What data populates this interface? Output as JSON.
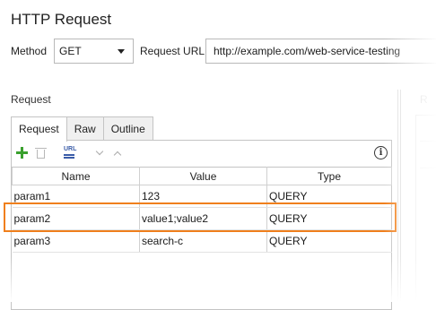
{
  "window": {
    "title": "HTTP Request"
  },
  "request_line": {
    "method_label": "Method",
    "method_value": "GET",
    "url_label": "Request URL:",
    "url_value": "http://example.com/web-service-testing"
  },
  "request_section": {
    "label": "Request",
    "tabs": [
      {
        "label": "Request",
        "active": true
      },
      {
        "label": "Raw",
        "active": false
      },
      {
        "label": "Outline",
        "active": false
      }
    ],
    "toolbar": {
      "icons": [
        "add-icon",
        "delete-icon",
        "url-parameters-icon",
        "move-down-icon",
        "move-up-icon",
        "info-icon"
      ],
      "info_glyph": "i"
    },
    "table": {
      "columns": [
        "Name",
        "Value",
        "Type"
      ],
      "rows": [
        [
          "param1",
          "123",
          "QUERY"
        ],
        [
          "param2",
          "value1;value2",
          "QUERY"
        ],
        [
          "param3",
          "search-c",
          "QUERY"
        ]
      ],
      "highlighted_row": 1
    }
  },
  "right_panel": {
    "label": "R"
  },
  "colors": {
    "highlight": "#f07f1c",
    "add_icon": "#3aa02e",
    "url_icon": "#3a5ca8"
  }
}
